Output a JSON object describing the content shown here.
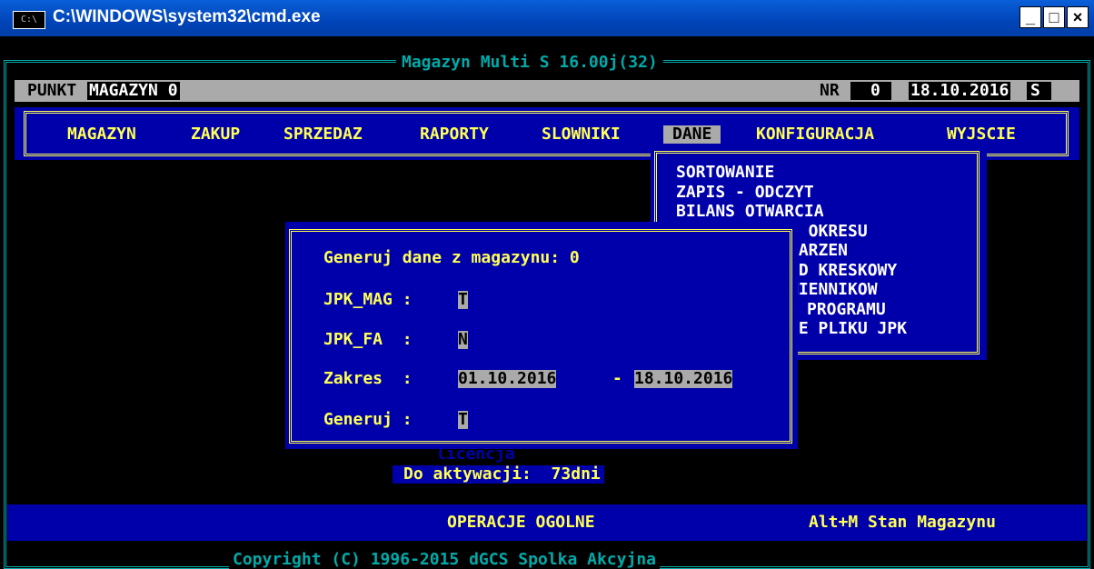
{
  "window": {
    "title": "C:\\WINDOWS\\system32\\cmd.exe",
    "icon_label": "C:\\",
    "minimize": "_",
    "maximize": "□",
    "close": "×"
  },
  "app": {
    "title": "Magazyn Multi S 16.00j(32)",
    "copyright": "Copyright (C) 1996-2015 dGCS Spolka Akcyjna"
  },
  "status": {
    "punkt_label": "PUNKT",
    "punkt_value": "MAGAZYN 0",
    "nr_label": "NR",
    "nr_value": "0",
    "date": "18.10.2016",
    "s_flag": "S"
  },
  "menu": {
    "items": [
      "MAGAZYN",
      "ZAKUP",
      "SPRZEDAZ",
      "RAPORTY",
      "SLOWNIKI",
      "DANE",
      "KONFIGURACJA",
      "WYJSCIE"
    ],
    "active": "DANE"
  },
  "dropdown": {
    "items": [
      "SORTOWANIE",
      "ZAPIS - ODCZYT",
      "BILANS OTWARCIA",
      "E OKRESU",
      "DARZEN",
      "OD KRESKOWY",
      "MIENNIKOW",
      "PROGRAMU",
      "IE PLIKU JPK"
    ]
  },
  "dialog": {
    "heading": "Generuj dane z magazynu: 0",
    "jpk_mag_label": "JPK_MAG :",
    "jpk_mag_value": "T",
    "jpk_fa_label": "JPK_FA  :",
    "jpk_fa_value": "N",
    "zakres_label": "Zakres  :",
    "date_from": "01.10.2016",
    "date_sep": "-",
    "date_to": "18.10.2016",
    "generuj_label": "Generuj :",
    "generuj_value": "T"
  },
  "license": {
    "label": "licencja",
    "activation": "Do aktywacji:  73dni"
  },
  "bottom": {
    "operation": "OPERACJE OGOLNE",
    "hint": "Alt+M Stan Magazynu"
  }
}
